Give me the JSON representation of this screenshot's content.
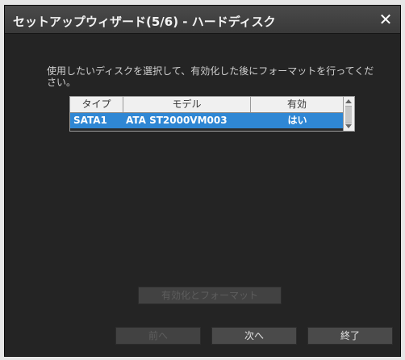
{
  "dialog": {
    "title": "セットアップウィザード(5/6) - ハードディスク",
    "close_icon": "close-icon"
  },
  "instruction": "使用したいディスクを選択して、有効化した後にフォーマットを行ってください。",
  "table": {
    "columns": [
      "タイプ",
      "モデル",
      "有効"
    ],
    "rows": [
      {
        "type": "SATA1",
        "model": "ATA ST2000VM003",
        "enabled": "はい"
      }
    ],
    "selected_row_color": "#2f87d4"
  },
  "buttons": {
    "format": "有効化とフォーマット",
    "prev": "前へ",
    "next": "次へ",
    "end": "終了"
  }
}
